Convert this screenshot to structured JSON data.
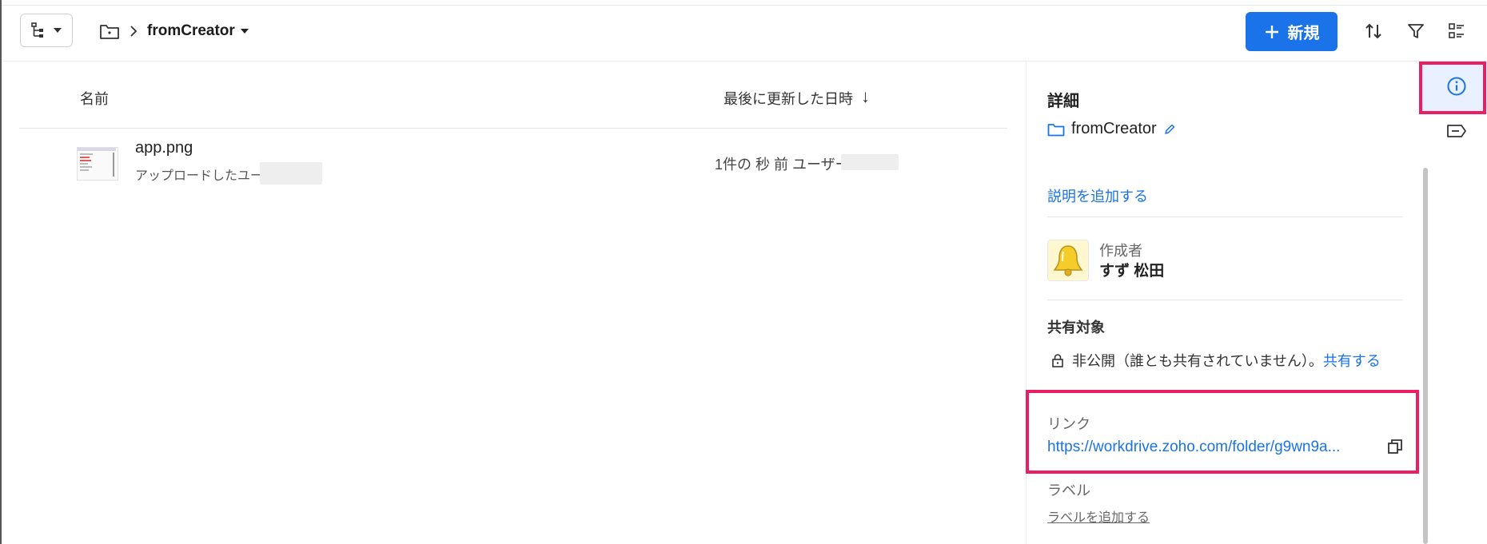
{
  "breadcrumb": {
    "current": "fromCreator"
  },
  "toolbar": {
    "new_label": "新規"
  },
  "table": {
    "col_name": "名前",
    "col_modified": "最後に更新した日時",
    "sort_arrow": "↓",
    "rows": [
      {
        "name": "app.png",
        "uploaded_by": "アップロードしたユーザー",
        "modified": "1件の 秒 前 ユーザー"
      }
    ]
  },
  "details": {
    "title": "詳細",
    "folder_name": "fromCreator",
    "add_description": "説明を追加する",
    "creator_label": "作成者",
    "creator_name": "すず 松田",
    "shared_label": "共有対象",
    "shared_status": "非公開（誰とも共有されていません）。",
    "share_link": "共有する",
    "link_label": "リンク",
    "link_url": "https://workdrive.zoho.com/folder/g9wn9a...",
    "label_title": "ラベル",
    "label_add": "ラベルを追加する"
  },
  "colors": {
    "accent": "#1a73e8",
    "highlight": "#e91e63"
  }
}
